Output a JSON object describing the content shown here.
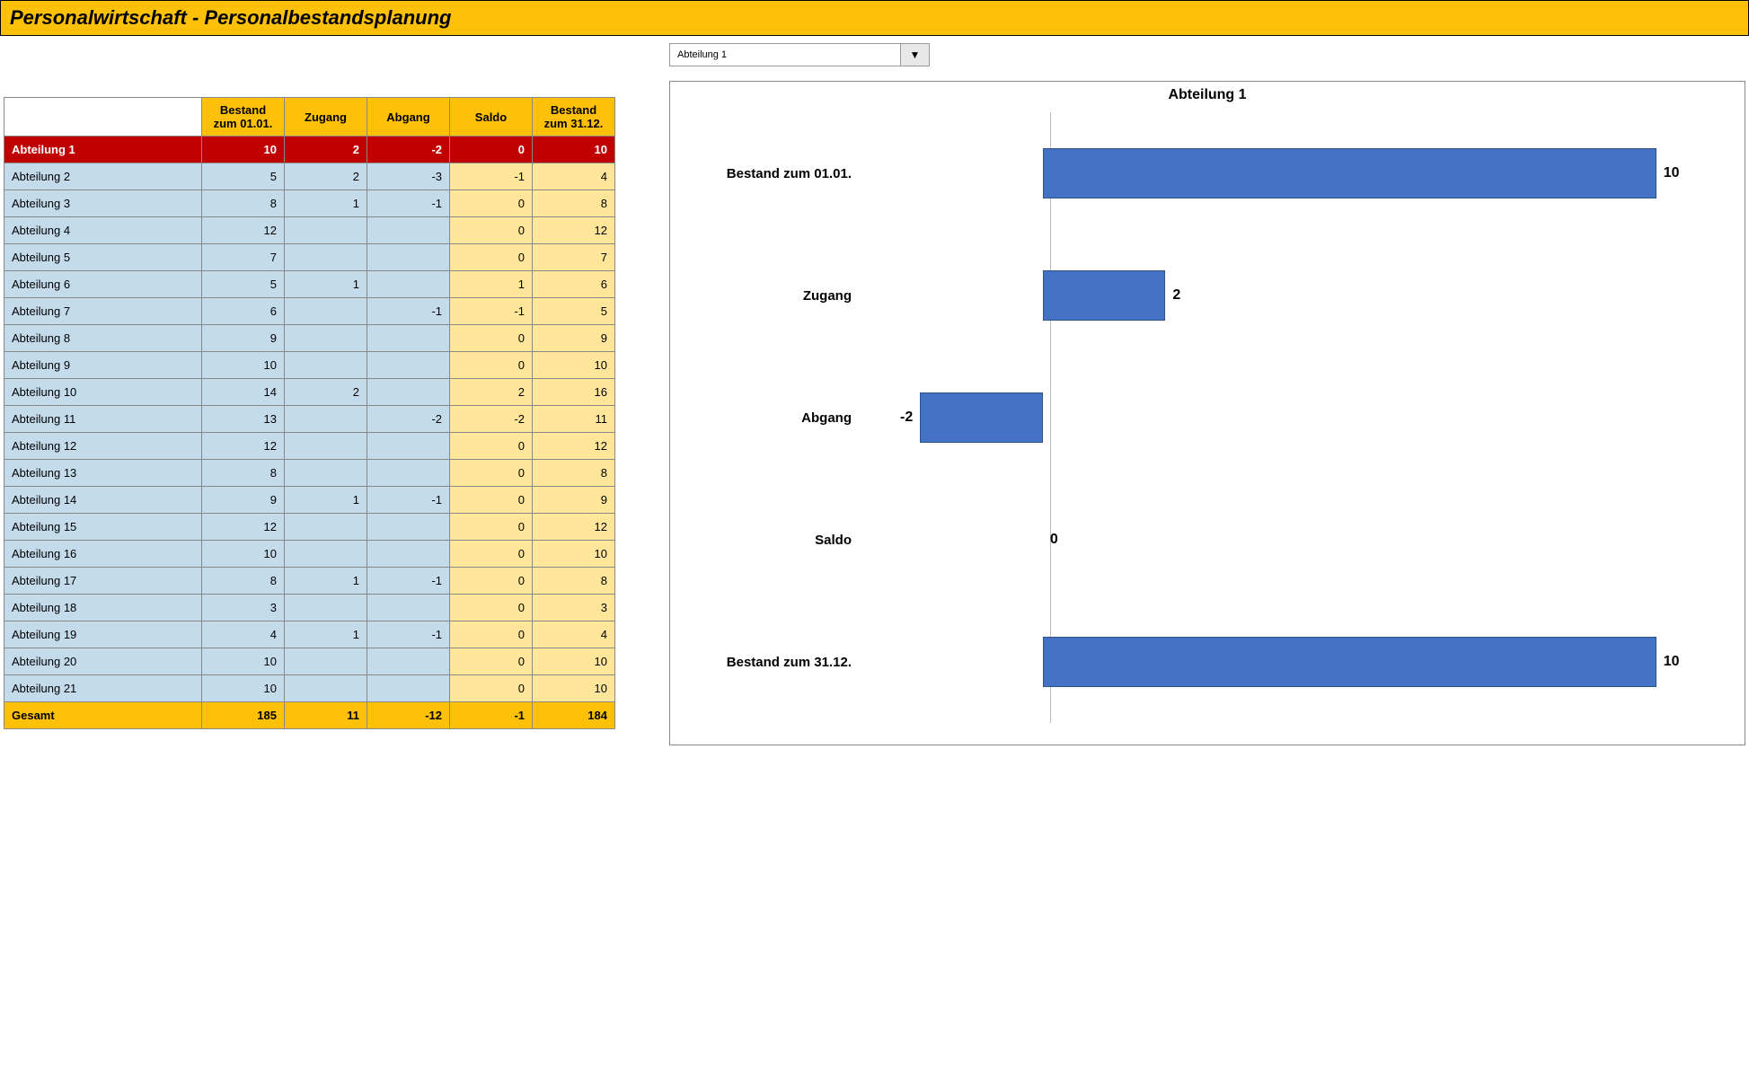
{
  "title": "Personalwirtschaft - Personalbestandsplanung",
  "columns": [
    "Bestand zum 01.01.",
    "Zugang",
    "Abgang",
    "Saldo",
    "Bestand zum 31.12."
  ],
  "col_tint": [
    "blue",
    "blue",
    "blue",
    "yell",
    "yell"
  ],
  "selected_index": 0,
  "rows": [
    {
      "label": "Abteilung 1",
      "v": [
        "10",
        "2",
        "-2",
        "0",
        "10"
      ]
    },
    {
      "label": "Abteilung 2",
      "v": [
        "5",
        "2",
        "-3",
        "-1",
        "4"
      ]
    },
    {
      "label": "Abteilung 3",
      "v": [
        "8",
        "1",
        "-1",
        "0",
        "8"
      ]
    },
    {
      "label": "Abteilung 4",
      "v": [
        "12",
        "",
        "",
        "0",
        "12"
      ]
    },
    {
      "label": "Abteilung 5",
      "v": [
        "7",
        "",
        "",
        "0",
        "7"
      ]
    },
    {
      "label": "Abteilung 6",
      "v": [
        "5",
        "1",
        "",
        "1",
        "6"
      ]
    },
    {
      "label": "Abteilung 7",
      "v": [
        "6",
        "",
        "-1",
        "-1",
        "5"
      ]
    },
    {
      "label": "Abteilung 8",
      "v": [
        "9",
        "",
        "",
        "0",
        "9"
      ]
    },
    {
      "label": "Abteilung 9",
      "v": [
        "10",
        "",
        "",
        "0",
        "10"
      ]
    },
    {
      "label": "Abteilung 10",
      "v": [
        "14",
        "2",
        "",
        "2",
        "16"
      ]
    },
    {
      "label": "Abteilung 11",
      "v": [
        "13",
        "",
        "-2",
        "-2",
        "11"
      ]
    },
    {
      "label": "Abteilung 12",
      "v": [
        "12",
        "",
        "",
        "0",
        "12"
      ]
    },
    {
      "label": "Abteilung 13",
      "v": [
        "8",
        "",
        "",
        "0",
        "8"
      ]
    },
    {
      "label": "Abteilung 14",
      "v": [
        "9",
        "1",
        "-1",
        "0",
        "9"
      ]
    },
    {
      "label": "Abteilung 15",
      "v": [
        "12",
        "",
        "",
        "0",
        "12"
      ]
    },
    {
      "label": "Abteilung 16",
      "v": [
        "10",
        "",
        "",
        "0",
        "10"
      ]
    },
    {
      "label": "Abteilung 17",
      "v": [
        "8",
        "1",
        "-1",
        "0",
        "8"
      ]
    },
    {
      "label": "Abteilung 18",
      "v": [
        "3",
        "",
        "",
        "0",
        "3"
      ]
    },
    {
      "label": "Abteilung 19",
      "v": [
        "4",
        "1",
        "-1",
        "0",
        "4"
      ]
    },
    {
      "label": "Abteilung 20",
      "v": [
        "10",
        "",
        "",
        "0",
        "10"
      ]
    },
    {
      "label": "Abteilung 21",
      "v": [
        "10",
        "",
        "",
        "0",
        "10"
      ]
    }
  ],
  "total": {
    "label": "Gesamt",
    "v": [
      "185",
      "11",
      "-12",
      "-1",
      "184"
    ]
  },
  "dropdown": {
    "value": "Abteilung 1"
  },
  "chart_data": {
    "type": "bar",
    "orientation": "horizontal",
    "title": "Abteilung 1",
    "categories": [
      "Bestand zum 01.01.",
      "Zugang",
      "Abgang",
      "Saldo",
      "Bestand zum 31.12."
    ],
    "values": [
      10,
      2,
      -2,
      0,
      10
    ],
    "xlim": [
      -3,
      11
    ],
    "bar_color": "#4472c4"
  }
}
